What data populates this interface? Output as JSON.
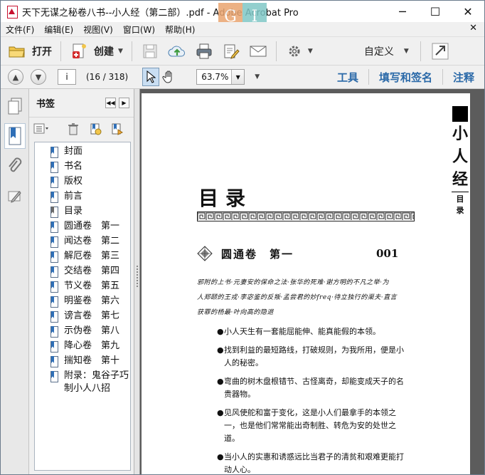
{
  "window": {
    "title": "天下无谋之秘卷八书--小人经（第二部）.pdf - Adobe Acrobat Pro",
    "controls": {
      "minimize": "─",
      "maximize": "☐",
      "close": "✕"
    }
  },
  "menu": {
    "items": [
      "文件(F)",
      "编辑(E)",
      "视图(V)",
      "窗口(W)",
      "帮助(H)"
    ],
    "close_glyph": "✕"
  },
  "toolbar": {
    "open_label": "打开",
    "create_label": "创建",
    "custom_label": "自定义"
  },
  "nav": {
    "page_input": "i",
    "page_count": "(16 / 318)",
    "zoom": "63.7%",
    "panels": [
      "工具",
      "填写和签名",
      "注释"
    ]
  },
  "bookmarks": {
    "title": "书签",
    "items": [
      {
        "label": "封面",
        "icon": "bookmark-icon"
      },
      {
        "label": "书名",
        "icon": "bookmark-icon"
      },
      {
        "label": "版权",
        "icon": "bookmark-icon"
      },
      {
        "label": "前言",
        "icon": "bookmark-icon"
      },
      {
        "label": "目录",
        "icon": "bookmark-current-icon"
      },
      {
        "label": "圆通卷　第一",
        "icon": "bookmark-icon"
      },
      {
        "label": "闻达卷　第二",
        "icon": "bookmark-icon"
      },
      {
        "label": "解厄卷　第三",
        "icon": "bookmark-icon"
      },
      {
        "label": "交结卷　第四",
        "icon": "bookmark-icon"
      },
      {
        "label": "节义卷　第五",
        "icon": "bookmark-icon"
      },
      {
        "label": "明鉴卷　第六",
        "icon": "bookmark-icon"
      },
      {
        "label": "谤言卷　第七",
        "icon": "bookmark-icon"
      },
      {
        "label": "示伪卷　第八",
        "icon": "bookmark-icon"
      },
      {
        "label": "降心卷　第九",
        "icon": "bookmark-icon"
      },
      {
        "label": "揣知卷　第十",
        "icon": "bookmark-icon"
      },
      {
        "label": "附录：鬼谷子巧\n制小人八招",
        "icon": "bookmark-icon"
      }
    ]
  },
  "document": {
    "side_title": [
      "小",
      "人",
      "经"
    ],
    "side_sub": [
      "目",
      "录"
    ],
    "toc_title": "目录",
    "section_name": "圆通卷　第一",
    "section_num": "001",
    "intro_lines": [
      "邪附的上书·元妻安的保命之法·张华的死难·谢方明的不凡之举·为",
      "人郑颐的王戎·李宓鉴的反叛·孟尝君的妙freq·待立独行的渠夫·直言",
      "获罪的杨最·叶向高的隐退"
    ],
    "bullets": [
      "小人天生有一套能屈能伸、能真能假的本领。",
      "找到利益的最短路线，打破规则，为我所用，便是小人的秘密。",
      "弯曲的树木盘根错节、古怪离奇，却能变成天子的名贵器物。",
      "见风使舵和富于变化，这是小人们最拿手的本领之一，也是他们常常能出奇制胜、转危为安的处世之道。",
      "当小人的实惠和诱惑远比当君子的清贫和艰难更能打动人心。"
    ]
  }
}
